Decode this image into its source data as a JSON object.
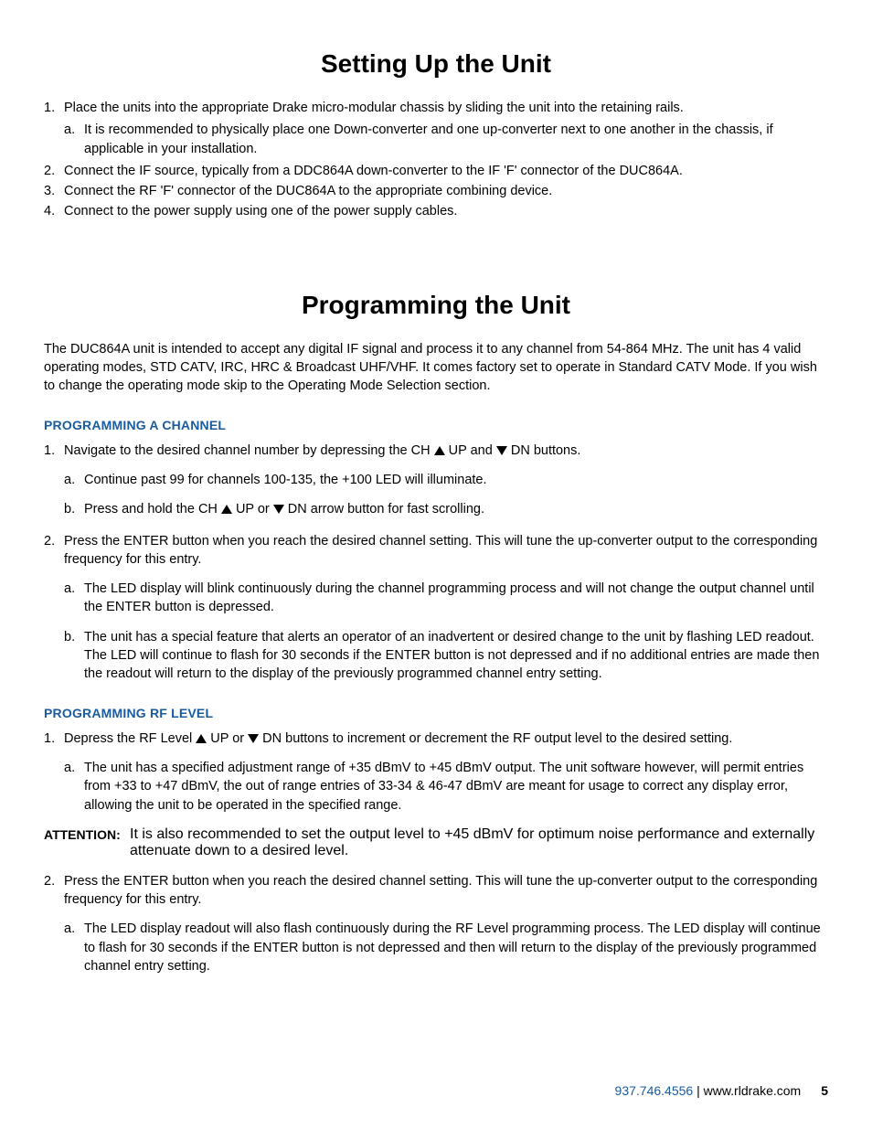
{
  "heading1": "Setting Up the Unit",
  "setup": {
    "i1_pre": "Place the units into the appropriate Drake micro-modular chassis by sliding the unit into the retaining rails.",
    "i1a": "It is recommended to physically place one Down-converter and one up-converter next to one another in the chassis, if applicable in your installation.",
    "i2": "Connect the IF source, typically from a DDC864A down-converter to the IF 'F' connector of the DUC864A.",
    "i3": "Connect the RF 'F' connector of the DUC864A to the appropriate combining device.",
    "i4": "Connect to the power supply using one of the power supply cables."
  },
  "heading2": "Programming the Unit",
  "intro": "The DUC864A unit is intended to accept any digital IF signal and process it to any channel from 54-864 MHz. The unit has 4 valid operating modes, STD CATV, IRC, HRC & Broadcast UHF/VHF. It comes factory set to operate in Standard CATV Mode. If you wish to change the operating mode skip to the Operating Mode Selection section.",
  "sec_channel_title": "PROGRAMMING A CHANNEL",
  "ch": {
    "i1_a": "Navigate to the desired channel number by depressing the CH ",
    "i1_b": " UP and ",
    "i1_c": " DN buttons.",
    "i1a": "Continue past 99 for channels 100-135, the +100 LED will illuminate.",
    "i1b_a": "Press and hold the CH ",
    "i1b_b": " UP or ",
    "i1b_c": " DN arrow button for fast scrolling.",
    "i2": "Press the ENTER button when you reach the desired channel setting. This will tune the up-converter output to the corresponding frequency for this entry.",
    "i2a": "The LED display will blink continuously during the channel programming process and will not change the output channel until the ENTER button is depressed.",
    "i2b": "The unit has a special feature that alerts an operator of an inadvertent or desired change to the unit by flashing LED readout. The LED will continue to flash for 30 seconds if the ENTER button is not depressed and if no additional entries are made then the readout will return to the display of the previously programmed channel entry setting."
  },
  "sec_rf_title": "PROGRAMMING RF LEVEL",
  "rf": {
    "i1_a": "Depress the RF Level ",
    "i1_b": " UP or ",
    "i1_c": " DN buttons to increment or decrement the RF output level to the desired setting.",
    "i1a": "The unit has a specified adjustment range of +35 dBmV to +45 dBmV output. The unit software however, will permit entries from +33 to +47 dBmV, the out of range entries of 33-34 & 46-47 dBmV are meant for usage to correct any display error, allowing the unit to be operated in the specified range.",
    "attn_label": "ATTENTION:",
    "attn_body": "It is also recommended to set the output level to +45 dBmV for optimum noise performance and externally attenuate down to a desired level.",
    "i2": "Press the ENTER button when you reach the desired channel setting. This will tune the up-converter output to the corresponding frequency for this entry.",
    "i2a": "The LED display readout will also flash continuously during the RF Level programming process. The LED display will continue to flash for 30 seconds if the ENTER button is not depressed and then will return to the display of the previously programmed channel entry setting."
  },
  "footer": {
    "phone": "937.746.4556",
    "sep": " | ",
    "url": "www.rldrake.com",
    "page": "5"
  }
}
